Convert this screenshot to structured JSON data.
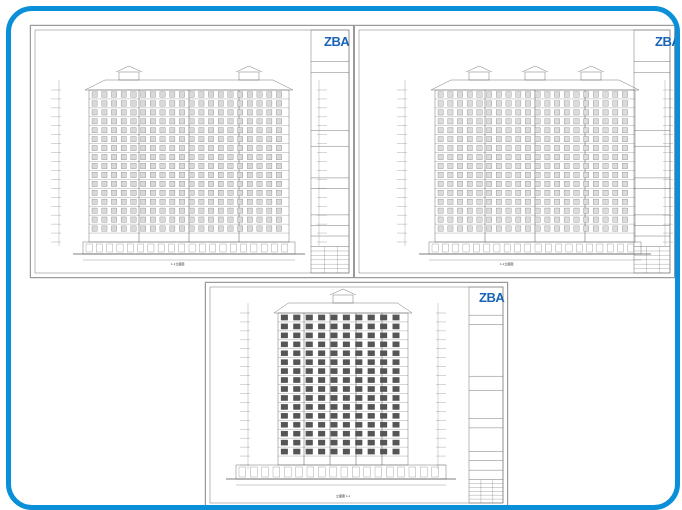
{
  "sheets": [
    {
      "id": "sheet-top-left",
      "logo": "ZBA",
      "scale_label": "1-1立面图"
    },
    {
      "id": "sheet-top-right",
      "logo": "ZBA",
      "scale_label": "1-1立面图"
    },
    {
      "id": "sheet-bottom",
      "logo": "ZBA",
      "scale_label": "立面图 1-1"
    }
  ],
  "colors": {
    "frame": "#0a8fd9",
    "line": "#555555",
    "logo": "#1a63b8"
  }
}
